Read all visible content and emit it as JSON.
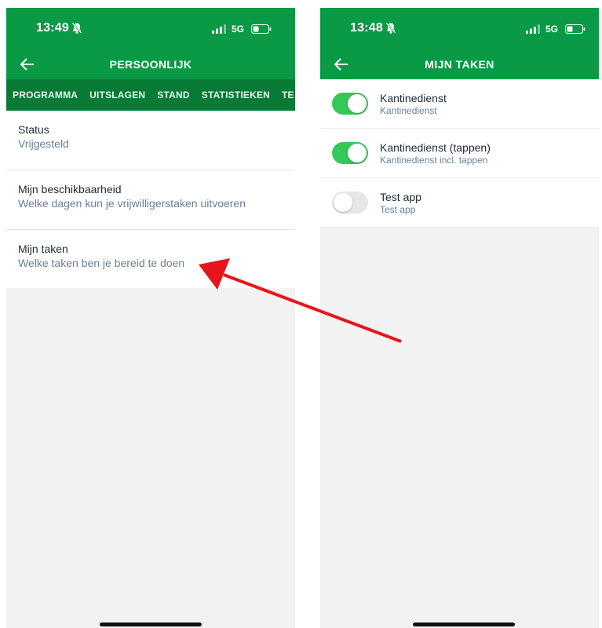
{
  "left": {
    "status": {
      "time": "13:49",
      "network": "5G"
    },
    "appbar": {
      "title": "PERSOONLIJK"
    },
    "tabs": [
      "PROGRAMMA",
      "UITSLAGEN",
      "STAND",
      "STATISTIEKEN",
      "TE"
    ],
    "items": [
      {
        "title": "Status",
        "subtitle": "Vrijgesteld"
      },
      {
        "title": "Mijn beschikbaarheid",
        "subtitle": "Welke dagen kun je vrijwilligerstaken uitvoeren"
      },
      {
        "title": "Mijn taken",
        "subtitle": "Welke taken ben je bereid te doen"
      }
    ]
  },
  "right": {
    "status": {
      "time": "13:48",
      "network": "5G"
    },
    "appbar": {
      "title": "MIJN TAKEN"
    },
    "tasks": [
      {
        "title": "Kantinedienst",
        "subtitle": "Kantinedienst",
        "enabled": true
      },
      {
        "title": "Kantinedienst (tappen)",
        "subtitle": "Kantinedienst incl. tappen",
        "enabled": true
      },
      {
        "title": "Test app",
        "subtitle": "Test app",
        "enabled": false
      }
    ]
  },
  "colors": {
    "brand": "#0a9a45",
    "tabbar": "#077a35",
    "toggle_on": "#34c759",
    "arrow": "#e8141b"
  },
  "icons": [
    "bell-slash-icon",
    "signal-icon",
    "battery-icon",
    "back-arrow-icon"
  ]
}
